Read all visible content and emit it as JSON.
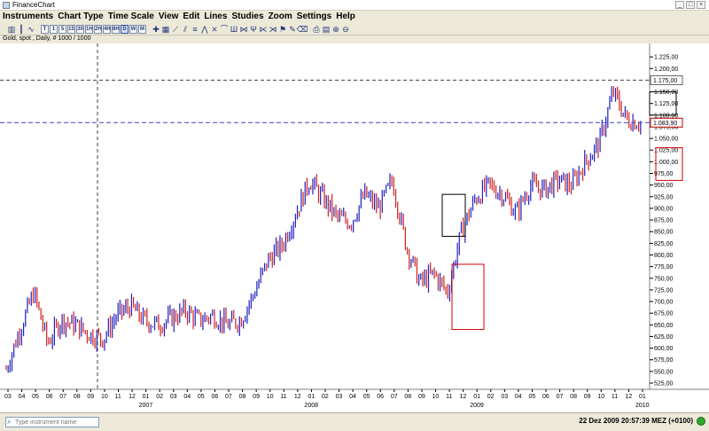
{
  "window": {
    "title": "FinanceChart"
  },
  "menu": [
    "Instruments",
    "Chart Type",
    "Time Scale",
    "View",
    "Edit",
    "Lines",
    "Studies",
    "Zoom",
    "Settings",
    "Help"
  ],
  "toolbar": {
    "timeframes": [
      "T",
      "1",
      "5",
      "15",
      "30",
      "1H",
      "2H",
      "4H",
      "8H",
      "D",
      "W",
      "M"
    ],
    "selected_timeframe": "D",
    "tool_icons": [
      "chart-type-icon",
      "crosshair-icon",
      "trendline-icon",
      "fibonacci-icon",
      "gann-icon",
      "pencil-icon",
      "print-icon",
      "zoom-in-icon",
      "zoom-out-icon"
    ]
  },
  "chart": {
    "instrument_info": "Gold, spot , Daily, # 1000 / 1000",
    "last_price_label": "1.083,90",
    "crosshair_price_label": "1.175,00",
    "colors": {
      "up": "#2020c0",
      "down": "#d02020",
      "crosshair": "#404040",
      "price_line": "#4040c0",
      "box_black": "#000000",
      "box_red": "#d00000"
    }
  },
  "chart_data": {
    "type": "candlestick",
    "y_ticks": [
      "1.225,00",
      "1.200,00",
      "1.175,00",
      "1.150,00",
      "1.125,00",
      "1.100,00",
      "1.075,00",
      "1.050,00",
      "1.025,00",
      "1.000,00",
      "975,00",
      "950,00",
      "925,00",
      "900,00",
      "875,00",
      "850,00",
      "825,00",
      "800,00",
      "775,00",
      "750,00",
      "725,00",
      "700,00",
      "675,00",
      "650,00",
      "625,00",
      "600,00",
      "575,00",
      "550,00",
      "525,00"
    ],
    "y_range": [
      525,
      1250
    ],
    "month_labels": [
      "03",
      "04",
      "05",
      "06",
      "07",
      "08",
      "09",
      "10",
      "11",
      "12",
      "01",
      "02",
      "03",
      "04",
      "05",
      "06",
      "07",
      "08",
      "09",
      "10",
      "11",
      "12",
      "01",
      "02",
      "03",
      "04",
      "05",
      "06",
      "07",
      "08",
      "09",
      "10",
      "11",
      "12",
      "01",
      "02",
      "03",
      "04",
      "05",
      "06",
      "07",
      "08",
      "09",
      "10",
      "11",
      "12",
      "01"
    ],
    "year_labels": [
      {
        "label": "2007",
        "month_index": 10
      },
      {
        "label": "2008",
        "month_index": 22
      },
      {
        "label": "2009",
        "month_index": 34
      },
      {
        "label": "2010",
        "month_index": 46
      }
    ],
    "approx_monthly_close": [
      555,
      640,
      720,
      610,
      660,
      650,
      630,
      620,
      670,
      690,
      660,
      650,
      665,
      680,
      660,
      670,
      650,
      660,
      720,
      790,
      820,
      890,
      960,
      920,
      880,
      870,
      930,
      900,
      960,
      820,
      740,
      760,
      720,
      850,
      920,
      950,
      930,
      890,
      950,
      940,
      960,
      950,
      1000,
      1040,
      1150,
      1090,
      1084
    ],
    "last_price": 1083.9,
    "crosshair_price": 1175
  },
  "status": {
    "instrument_placeholder": "Type instrument name",
    "clock": "22 Dez 2009 20:57:39  MEZ (+0100)"
  }
}
